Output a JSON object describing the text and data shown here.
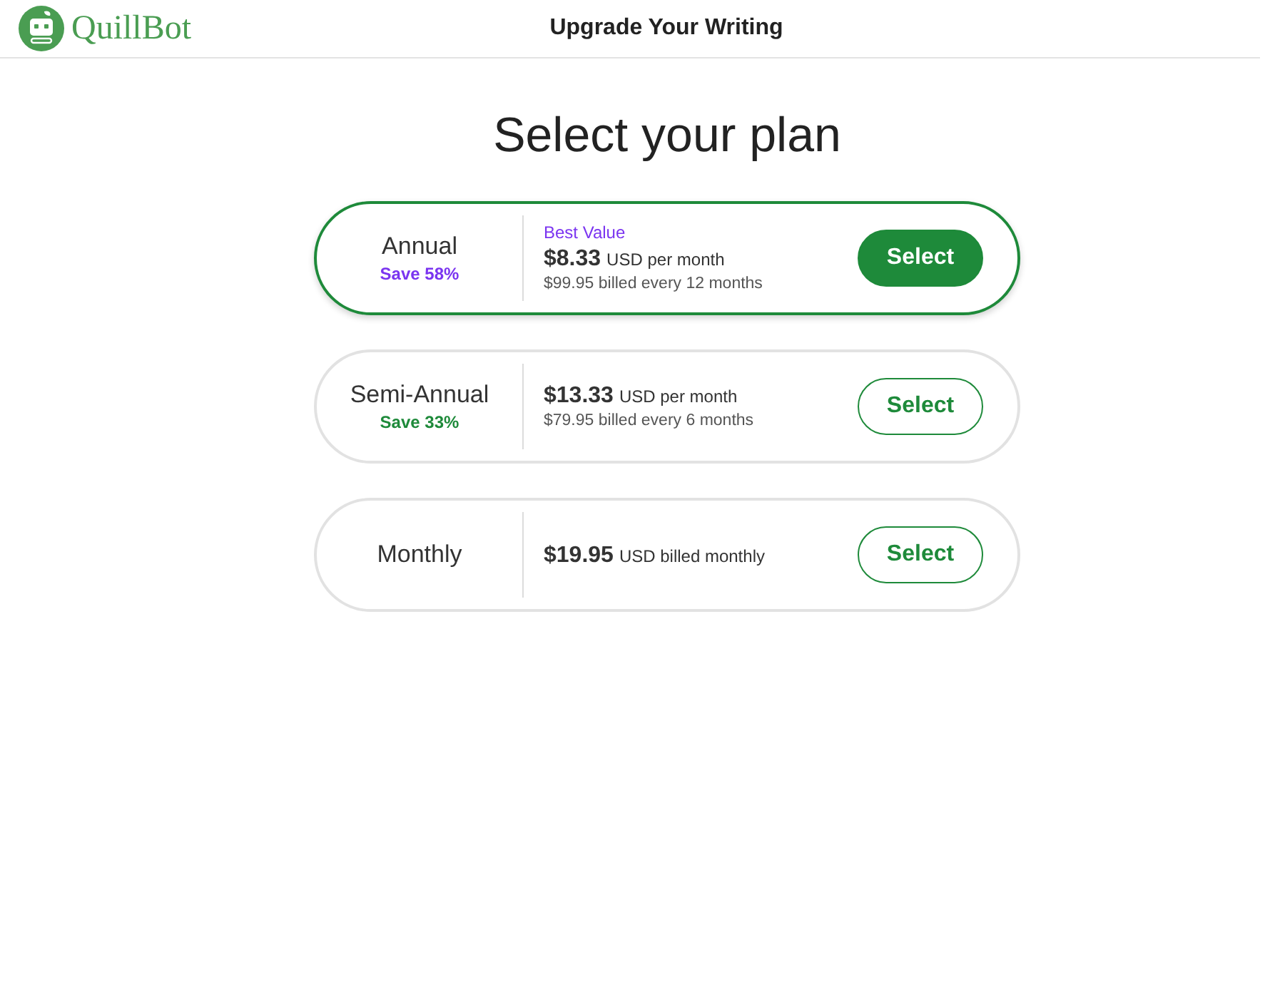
{
  "header": {
    "logo_text": "QuillBot",
    "title": "Upgrade Your Writing"
  },
  "heading": "Select your plan",
  "plans": [
    {
      "name": "Annual",
      "save": {
        "text": "Save 58%",
        "color": "#7b35f0"
      },
      "badge": "Best Value",
      "price": "$8.33",
      "unit": "USD per month",
      "billed": "$99.95 billed every 12 months",
      "button": "Select",
      "selected": true
    },
    {
      "name": "Semi-Annual",
      "save": {
        "text": "Save 33%",
        "color": "#1e8a3a"
      },
      "price": "$13.33",
      "unit": "USD per month",
      "billed": "$79.95 billed every 6 months",
      "button": "Select",
      "selected": false
    },
    {
      "name": "Monthly",
      "price": "$19.95",
      "unit": "USD billed monthly",
      "button": "Select",
      "selected": false
    }
  ]
}
